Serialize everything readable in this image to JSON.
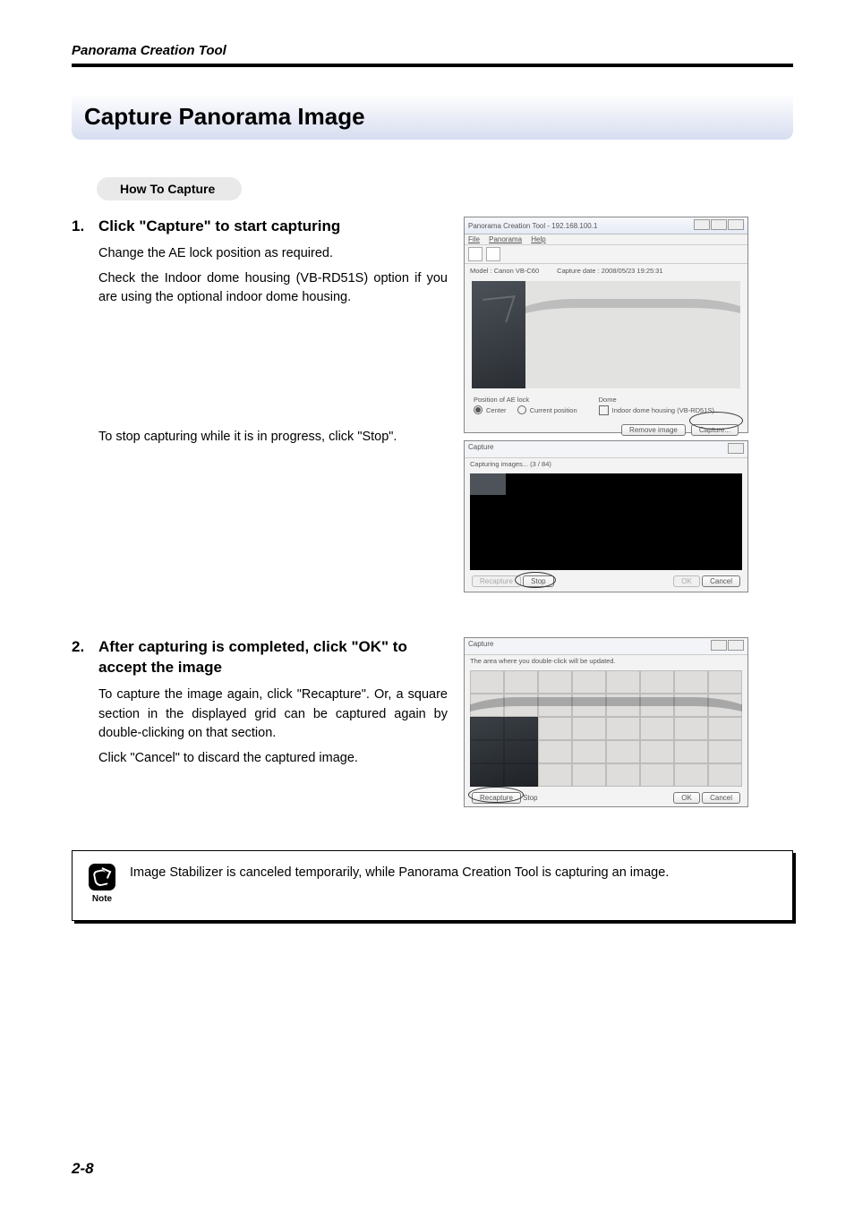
{
  "header": {
    "title": "Panorama Creation Tool"
  },
  "chapter": {
    "title": "Capture Panorama Image"
  },
  "subhead": {
    "label": "How To Capture"
  },
  "steps": [
    {
      "num": "1.",
      "head": "Click  \"Capture\" to start capturing",
      "body_a": "Change the AE lock position as required.",
      "body_b": "Check the Indoor dome housing (VB-RD51S) option if you are using the optional indoor dome housing.",
      "body_c": "To stop capturing while it is in progress, click \"Stop\"."
    },
    {
      "num": "2.",
      "head": "After capturing is completed, click \"OK\" to accept the image",
      "body_a": "To capture the image again, click \"Recapture\". Or, a square section in the displayed grid can be captured again by double-clicking on that section.",
      "body_b": "Click \"Cancel\" to discard the captured image."
    }
  ],
  "note": {
    "label": "Note",
    "text": "Image Stabilizer is canceled temporarily, while Panorama Creation Tool is capturing an image."
  },
  "page_number": "2-8",
  "shot1": {
    "title": "Panorama Creation Tool - 192.168.100.1",
    "menu_file": "File",
    "menu_panorama": "Panorama",
    "menu_help": "Help",
    "model_label": "Model :",
    "model_value": "Canon VB-C60",
    "date_label": "Capture date :",
    "date_value": "2008/05/23 19:25:31",
    "ae_title": "Position of AE lock",
    "ae_center": "Center",
    "ae_current": "Current position",
    "dome_title": "Dome",
    "dome_chk": "Indoor dome housing (VB-RD51S)",
    "btn_remove": "Remove image",
    "btn_capture": "Capture..."
  },
  "shot2": {
    "title": "Capture",
    "progress": "Capturing images...  (3 / 84)",
    "btn_recapture": "Recapture",
    "btn_stop": "Stop",
    "btn_ok": "OK",
    "btn_cancel": "Cancel"
  },
  "shot3": {
    "title": "Capture",
    "msg": "The area where you double-click will be updated.",
    "btn_recapture": "Recapture",
    "btn_stop": "Stop",
    "btn_ok": "OK",
    "btn_cancel": "Cancel"
  }
}
